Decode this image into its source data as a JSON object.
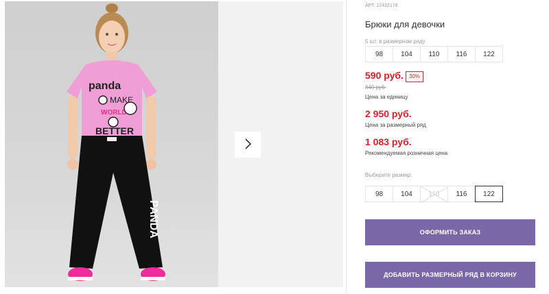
{
  "product": {
    "article": "АРТ. 12422178",
    "title": "Брюки для девочки",
    "pack_label": "5 шт. в размерном ряду",
    "pack_sizes": [
      "98",
      "104",
      "110",
      "116",
      "122"
    ],
    "price": "590 руб.",
    "discount": "30%",
    "old_price": "840 руб.",
    "unit_label": "Цена за единицу",
    "set_price": "2 950 руб.",
    "set_label": "Цена за размерный ряд",
    "rrp_price": "1 083 руб.",
    "rrp_label": "Рекомендуемая розничная цена"
  },
  "size_picker": {
    "label": "Выберите размер:",
    "sizes": [
      {
        "label": "98",
        "state": "available"
      },
      {
        "label": "104",
        "state": "available"
      },
      {
        "label": "110",
        "state": "unavailable"
      },
      {
        "label": "116",
        "state": "available"
      },
      {
        "label": "122",
        "state": "selected"
      }
    ]
  },
  "tshirt_print": {
    "line1": "panda",
    "line2": "MAKE",
    "line3": "WORLD",
    "line4": "BETTER"
  },
  "pants_print": "PANDA",
  "actions": {
    "order_label": "ОФОРМИТЬ ЗАКАЗ",
    "add_set_label": "ДОБАВИТЬ РАЗМЕРНЫЙ РЯД В КОРЗИНУ"
  },
  "colors": {
    "price_red": "#d6202a",
    "button_purple": "#7a67a8"
  },
  "icons": {
    "gallery_next": "chevron-right-icon"
  }
}
